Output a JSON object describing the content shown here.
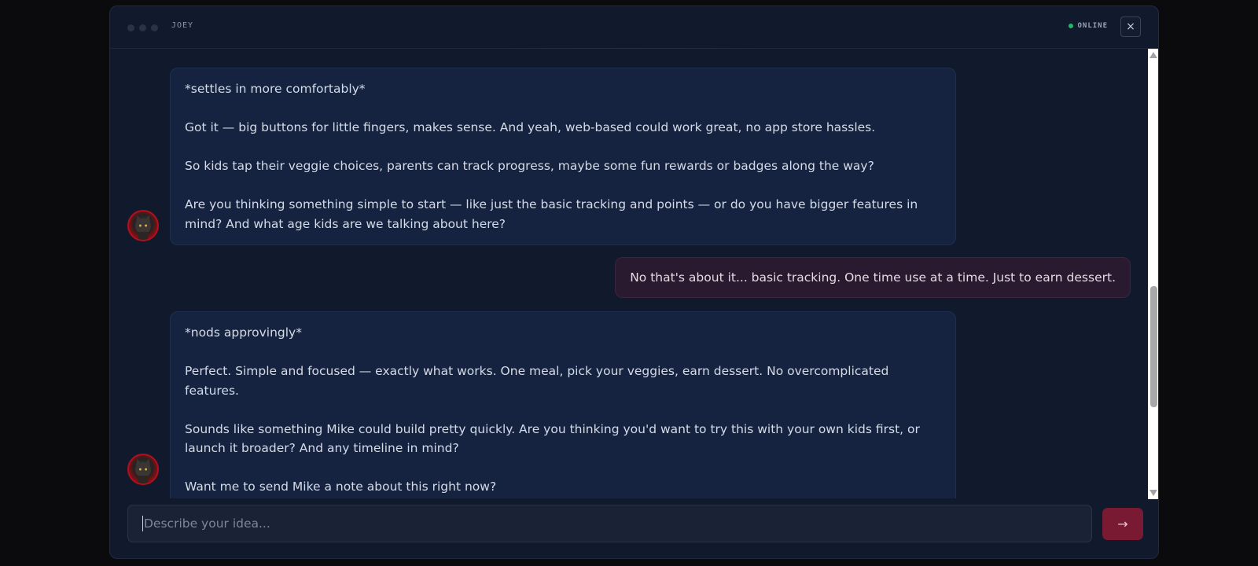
{
  "window": {
    "title": "JOEY",
    "status": "ONLINE",
    "close_icon": "×"
  },
  "messages": [
    {
      "role": "assistant",
      "paragraphs": [
        "*settles in more comfortably*",
        "Got it — big buttons for little fingers, makes sense. And yeah, web-based could work great, no app store hassles.",
        "So kids tap their veggie choices, parents can track progress, maybe some fun rewards or badges along the way?",
        "Are you thinking something simple to start — like just the basic tracking and points — or do you have bigger features in mind? And what age kids are we talking about here?"
      ]
    },
    {
      "role": "user",
      "text": "No that's about it... basic tracking. One time use at a time. Just to earn dessert."
    },
    {
      "role": "assistant",
      "paragraphs": [
        "*nods approvingly*",
        "Perfect. Simple and focused — exactly what works. One meal, pick your veggies, earn dessert. No overcomplicated features.",
        "Sounds like something Mike could build pretty quickly. Are you thinking you'd want to try this with your own kids first, or launch it broader? And any timeline in mind?",
        "Want me to send Mike a note about this right now?"
      ]
    }
  ],
  "composer": {
    "placeholder": "Describe your idea...",
    "send_icon": "→"
  },
  "colors": {
    "background": "#111a2c",
    "assistant_bubble": "#152340",
    "user_bubble": "#2a1a30",
    "send_button": "#7a1a32",
    "status_dot": "#1fb868"
  }
}
